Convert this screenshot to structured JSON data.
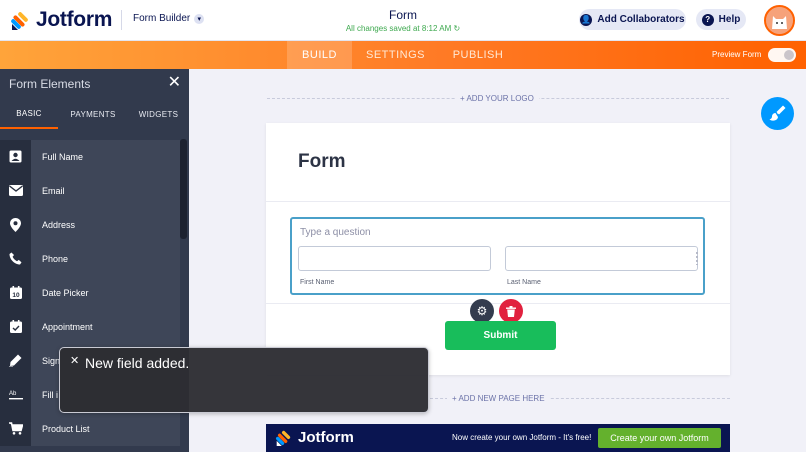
{
  "colors": {
    "brand_navy": "#0a1551",
    "brand_orange": "#ff6100",
    "submit_green": "#18bd5b",
    "sidebar_bg": "#323a4d"
  },
  "header": {
    "logo_text": "Jotform",
    "builder_label": "Form Builder",
    "form_title": "Form",
    "save_status": "All changes saved at 8:12 AM",
    "collaborators_label": "Add Collaborators",
    "help_label": "Help"
  },
  "builder_tabs": [
    {
      "label": "BUILD",
      "active": true
    },
    {
      "label": "SETTINGS",
      "active": false
    },
    {
      "label": "PUBLISH",
      "active": false
    }
  ],
  "preview_label": "Preview Form",
  "sidebar": {
    "title": "Form Elements",
    "tabs": [
      {
        "label": "BASIC",
        "active": true
      },
      {
        "label": "PAYMENTS",
        "active": false
      },
      {
        "label": "WIDGETS",
        "active": false
      }
    ],
    "items": [
      {
        "label": "Full Name",
        "icon": "person-card-icon"
      },
      {
        "label": "Email",
        "icon": "envelope-icon"
      },
      {
        "label": "Address",
        "icon": "map-pin-icon"
      },
      {
        "label": "Phone",
        "icon": "phone-icon"
      },
      {
        "label": "Date Picker",
        "icon": "calendar-icon"
      },
      {
        "label": "Appointment",
        "icon": "calendar-check-icon"
      },
      {
        "label": "Sign",
        "icon": "pen-icon"
      },
      {
        "label": "Fill i",
        "icon": "fill-blank-icon"
      },
      {
        "label": "Product List",
        "icon": "cart-icon"
      }
    ]
  },
  "canvas": {
    "add_logo_label": "+ ADD YOUR LOGO",
    "form_heading": "Form",
    "question_placeholder": "Type a question",
    "first_name_label": "First Name",
    "last_name_label": "Last Name",
    "submit_label": "Submit",
    "add_page_label": "+ ADD NEW PAGE HERE"
  },
  "banner": {
    "logo_text": "Jotform",
    "text": "Now create your own Jotform - It's free!",
    "button_label": "Create your own Jotform"
  },
  "toast": {
    "message": "New field added."
  }
}
